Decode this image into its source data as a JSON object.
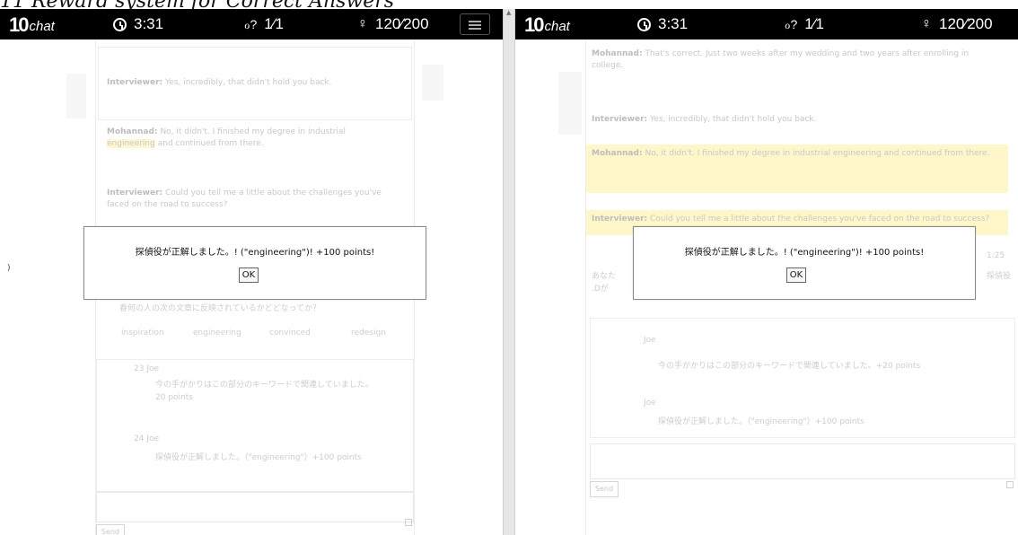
{
  "caption": "11 Reward system for Correct Answers",
  "left": {
    "logo_mark": "10",
    "logo_word": "chat",
    "timer": "3:31",
    "questions": "1⁄1",
    "points": "120⁄200",
    "messages": [
      {
        "speaker": "Interviewer:",
        "text": "Yes, incredibly, that didn't hold you back."
      },
      {
        "speaker": "Mohannad:",
        "text_before": "No, it didn't. I finished my degree in industrial",
        "highlight": "engineering",
        "text_after": "and continued from there."
      },
      {
        "speaker": "Interviewer:",
        "text": "Could you tell me a little about the challenges you've faced on the road to success?"
      }
    ],
    "question_line": "春何の人の次の文章に反映されているかどどなってか？",
    "keywords": [
      "inspiration",
      "engineering",
      "convinced",
      "redesign"
    ],
    "feedback": [
      {
        "label": "23 Joe",
        "text": "今の手がかりはこの部分のキーワードで関連していました。20 points"
      },
      {
        "label": "24 Joe",
        "text": "探偵役が正解しました。（\"engineering\"）+100 points"
      }
    ],
    "dialog_text": "探偵役が正解しました。! (\"engineering\")! +100 points!",
    "ok_label": "OK",
    "send_label": "Send",
    "stray_char": ")"
  },
  "right": {
    "logo_mark": "10",
    "logo_word": "chat",
    "timer": "3:31",
    "questions": "1⁄1",
    "points": "120⁄200",
    "messages": [
      {
        "speaker": "Mohannad:",
        "text": "That's correct. Just two weeks after my wedding and two years after enrolling in college."
      },
      {
        "speaker": "Interviewer:",
        "text": "Yes, incredibly, that didn't hold you back."
      },
      {
        "speaker": "Mohannad:",
        "text": "No, it didn't. I finished my degree in industrial engineering and continued from there."
      },
      {
        "speaker": "Interviewer:",
        "text": "Could you tell me a little about the challenges you've faced on the road to success?"
      }
    ],
    "side_left": "あなた",
    "side_left2": ".Dが",
    "side_right_time": "1:25",
    "side_right_label": "探偵役",
    "feedback": [
      {
        "label": "Joe",
        "text": "今の手がかりはこの部分のキーワードで関連していました。+20 points"
      },
      {
        "label": "Joe",
        "text": "探偵役が正解しました。（\"engineering\"）+100 points"
      }
    ],
    "dialog_text": "探偵役が正解しました。! (\"engineering\")! +100 points!",
    "ok_label": "OK",
    "send_label": "Send"
  }
}
